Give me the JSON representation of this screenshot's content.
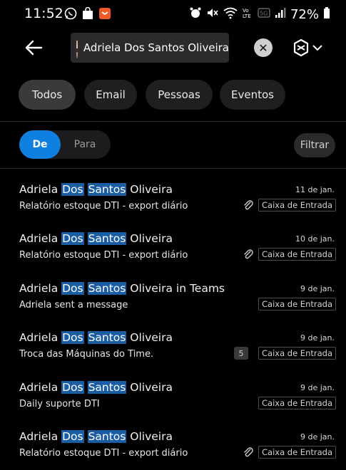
{
  "status_bar": {
    "time": "11:52",
    "battery": "72%"
  },
  "header": {
    "search_chip": "Adriela Dos Santos Oliveira"
  },
  "filters": {
    "all": "Todos",
    "email": "Email",
    "people": "Pessoas",
    "events": "Eventos"
  },
  "direction": {
    "from": "De",
    "to": "Para",
    "filter": "Filtrar"
  },
  "results": [
    {
      "sender": {
        "a": "Adriela ",
        "h1": "Dos",
        "h2": "Santos",
        "b": " Oliveira"
      },
      "subject": "Relatório estoque DTI - export diário",
      "date": "11 de jan.",
      "folder": "Caixa de Entrada"
    },
    {
      "sender": {
        "a": "Adriela ",
        "h1": "Dos",
        "h2": "Santos",
        "b": " Oliveira"
      },
      "subject": "Relatório estoque DTI - export diário",
      "date": "10 de jan.",
      "folder": "Caixa de Entrada"
    },
    {
      "sender": {
        "a": "Adriela ",
        "h1": "Dos",
        "h2": "Santos",
        "b": " Oliveira in Teams"
      },
      "subject": "Adriela sent a message",
      "date": "9 de jan.",
      "folder": "Caixa de Entrada"
    },
    {
      "sender": {
        "a": "Adriela ",
        "h1": "Dos",
        "h2": "Santos",
        "b": " Oliveira"
      },
      "subject": "Troca das Máquinas do Time.",
      "date": "9 de jan.",
      "folder": "Caixa de Entrada",
      "count": "5"
    },
    {
      "sender": {
        "a": "Adriela ",
        "h1": "Dos",
        "h2": "Santos",
        "b": " Oliveira"
      },
      "subject": "Daily suporte DTI",
      "date": "9 de jan.",
      "folder": "Caixa de Entrada"
    },
    {
      "sender": {
        "a": "Adriela ",
        "h1": "Dos",
        "h2": "Santos",
        "b": " Oliveira"
      },
      "subject": "Relatório estoque DTI - export diário",
      "date": "9 de jan.",
      "folder": "Caixa de Entrada"
    }
  ]
}
